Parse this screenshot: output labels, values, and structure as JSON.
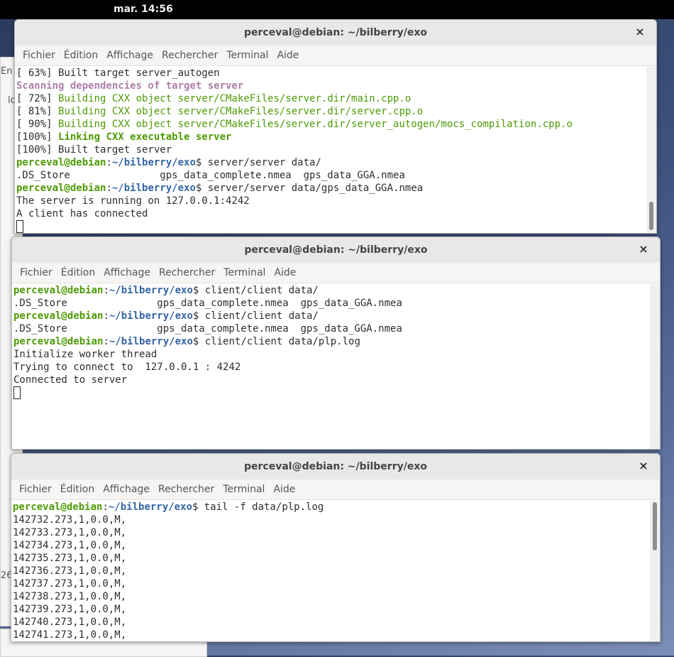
{
  "topbar": {
    "clock": "mar. 14:56"
  },
  "background": {
    "left_fragment_1": "En",
    "left_fragment_2": "lo",
    "left_fragment_3": "26"
  },
  "menu": [
    "Fichier",
    "Édition",
    "Affichage",
    "Rechercher",
    "Terminal",
    "Aide"
  ],
  "window1": {
    "title": "perceval@debian: ~/bilberry/exo",
    "close": "×",
    "lines": [
      {
        "parts": [
          {
            "t": "[ 63%] Built target server_autogen",
            "c": ""
          }
        ]
      },
      {
        "parts": [
          {
            "t": "Scanning dependencies of target server",
            "c": "mg"
          }
        ]
      },
      {
        "parts": [
          {
            "t": "[ 72%] ",
            "c": ""
          },
          {
            "t": "Building CXX object server/CMakeFiles/server.dir/main.cpp.o",
            "c": "gr"
          }
        ]
      },
      {
        "parts": [
          {
            "t": "[ 81%] ",
            "c": ""
          },
          {
            "t": "Building CXX object server/CMakeFiles/server.dir/server.cpp.o",
            "c": "gr"
          }
        ]
      },
      {
        "parts": [
          {
            "t": "[ 90%] ",
            "c": ""
          },
          {
            "t": "Building CXX object server/CMakeFiles/server.dir/server_autogen/mocs_compilation.cpp.o",
            "c": "gr"
          }
        ]
      },
      {
        "parts": [
          {
            "t": "[100%] ",
            "c": ""
          },
          {
            "t": "Linking CXX executable server",
            "c": "g"
          }
        ]
      },
      {
        "parts": [
          {
            "t": "[100%] Built target server",
            "c": ""
          }
        ]
      },
      {
        "parts": [
          {
            "t": "perceval@debian",
            "c": "g"
          },
          {
            "t": ":",
            "c": ""
          },
          {
            "t": "~/bilberry/exo",
            "c": "bl"
          },
          {
            "t": "$ server/server data/",
            "c": ""
          }
        ]
      },
      {
        "parts": [
          {
            "t": ".DS_Store               gps_data_complete.nmea  gps_data_GGA.nmea",
            "c": ""
          }
        ]
      },
      {
        "parts": [
          {
            "t": "perceval@debian",
            "c": "g"
          },
          {
            "t": ":",
            "c": ""
          },
          {
            "t": "~/bilberry/exo",
            "c": "bl"
          },
          {
            "t": "$ server/server data/gps_data_GGA.nmea",
            "c": ""
          }
        ]
      },
      {
        "parts": [
          {
            "t": "The server is running on 127.0.0.1:4242",
            "c": ""
          }
        ]
      },
      {
        "parts": [
          {
            "t": "A client has connected",
            "c": ""
          }
        ]
      }
    ]
  },
  "window2": {
    "title": "perceval@debian: ~/bilberry/exo",
    "close": "×",
    "lines": [
      {
        "parts": [
          {
            "t": "perceval@debian",
            "c": "g"
          },
          {
            "t": ":",
            "c": ""
          },
          {
            "t": "~/bilberry/exo",
            "c": "bl"
          },
          {
            "t": "$ client/client data/",
            "c": ""
          }
        ]
      },
      {
        "parts": [
          {
            "t": ".DS_Store               gps_data_complete.nmea  gps_data_GGA.nmea",
            "c": ""
          }
        ]
      },
      {
        "parts": [
          {
            "t": "perceval@debian",
            "c": "g"
          },
          {
            "t": ":",
            "c": ""
          },
          {
            "t": "~/bilberry/exo",
            "c": "bl"
          },
          {
            "t": "$ client/client data/",
            "c": ""
          }
        ]
      },
      {
        "parts": [
          {
            "t": ".DS_Store               gps_data_complete.nmea  gps_data_GGA.nmea",
            "c": ""
          }
        ]
      },
      {
        "parts": [
          {
            "t": "perceval@debian",
            "c": "g"
          },
          {
            "t": ":",
            "c": ""
          },
          {
            "t": "~/bilberry/exo",
            "c": "bl"
          },
          {
            "t": "$ client/client data/plp.log",
            "c": ""
          }
        ]
      },
      {
        "parts": [
          {
            "t": "Initialize worker thread",
            "c": ""
          }
        ]
      },
      {
        "parts": [
          {
            "t": "Trying to connect to  127.0.0.1 : 4242",
            "c": ""
          }
        ]
      },
      {
        "parts": [
          {
            "t": "Connected to server",
            "c": ""
          }
        ]
      }
    ]
  },
  "window3": {
    "title": "perceval@debian: ~/bilberry/exo",
    "close": "×",
    "lines": [
      {
        "parts": [
          {
            "t": "perceval@debian",
            "c": "g"
          },
          {
            "t": ":",
            "c": ""
          },
          {
            "t": "~/bilberry/exo",
            "c": "bl"
          },
          {
            "t": "$ tail -f data/plp.log",
            "c": ""
          }
        ]
      },
      {
        "parts": [
          {
            "t": "142732.273,1,0.0,M,",
            "c": ""
          }
        ]
      },
      {
        "parts": [
          {
            "t": "142733.273,1,0.0,M,",
            "c": ""
          }
        ]
      },
      {
        "parts": [
          {
            "t": "142734.273,1,0.0,M,",
            "c": ""
          }
        ]
      },
      {
        "parts": [
          {
            "t": "142735.273,1,0.0,M,",
            "c": ""
          }
        ]
      },
      {
        "parts": [
          {
            "t": "142736.273,1,0.0,M,",
            "c": ""
          }
        ]
      },
      {
        "parts": [
          {
            "t": "142737.273,1,0.0,M,",
            "c": ""
          }
        ]
      },
      {
        "parts": [
          {
            "t": "142738.273,1,0.0,M,",
            "c": ""
          }
        ]
      },
      {
        "parts": [
          {
            "t": "142739.273,1,0.0,M,",
            "c": ""
          }
        ]
      },
      {
        "parts": [
          {
            "t": "142740.273,1,0.0,M,",
            "c": ""
          }
        ]
      },
      {
        "parts": [
          {
            "t": "142741.273,1,0.0,M,",
            "c": ""
          }
        ]
      }
    ]
  }
}
